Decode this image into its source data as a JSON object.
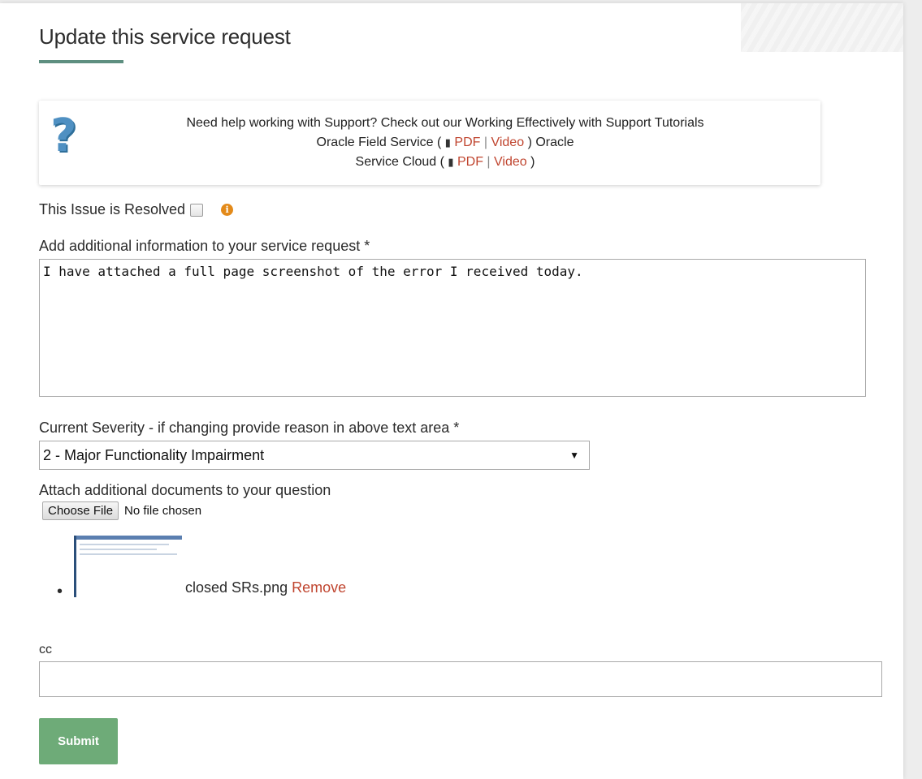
{
  "page": {
    "title": "Update this service request"
  },
  "help": {
    "line1": "Need help working with Support? Check out our Working Effectively with Support Tutorials",
    "ofs_label": "Oracle Field Service (",
    "ofs_pdf": "PDF",
    "ofs_sep": "|",
    "ofs_video": "Video",
    "ofs_tail": ") Oracle",
    "osc_label": "Service Cloud (",
    "osc_pdf": "PDF",
    "osc_sep": "|",
    "osc_video": "Video",
    "osc_tail": ")",
    "icon": "question-icon"
  },
  "resolved": {
    "label": "This Issue is Resolved",
    "checked": false
  },
  "additional_info": {
    "label": "Add additional information to your service request *",
    "value": "I have attached a full page screenshot of the error I received today."
  },
  "severity": {
    "label": "Current Severity - if changing provide reason in above text area *",
    "selected": "2 - Major Functionality Impairment"
  },
  "attachments": {
    "label": "Attach additional documents to your question",
    "choose_button": "Choose File",
    "status": "No file chosen",
    "files": [
      {
        "name": "closed SRs.png",
        "remove_label": "Remove"
      }
    ]
  },
  "cc": {
    "label": "cc",
    "value": ""
  },
  "submit_label": "Submit",
  "colors": {
    "accent": "#5e8f80",
    "link": "#c0452f",
    "submit": "#6eab78",
    "info": "#e38a1a"
  }
}
